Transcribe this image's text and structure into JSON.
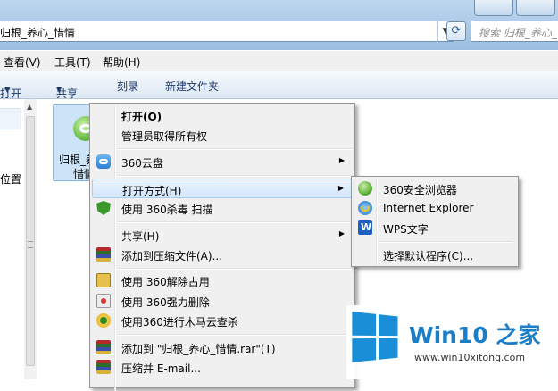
{
  "window": {
    "address_text": "归根_养心_惜情",
    "search_placeholder": "搜索 归根_养心_惜情"
  },
  "menubar": [
    "查看(V)",
    "工具(T)",
    "帮助(H)"
  ],
  "toolbar": {
    "open": "打开",
    "share": "共享",
    "burn": "刻录",
    "new_folder": "新建文件夹"
  },
  "navpane": {
    "location": "位置"
  },
  "file": {
    "name_line1": "归根_养",
    "name_line2": "惜情"
  },
  "context_menu": [
    {
      "label": "打开(O)",
      "bold": true,
      "icon": null
    },
    {
      "label": "管理员取得所有权",
      "icon": null
    },
    {
      "label": "360云盘",
      "icon": "cloud-icon",
      "submenu": true
    },
    {
      "label": "打开方式(H)",
      "icon": null,
      "submenu": true,
      "highlighted": true
    },
    {
      "label": "使用 360杀毒 扫描",
      "icon": "shield-icon"
    },
    {
      "label": "共享(H)",
      "icon": null,
      "submenu": true
    },
    {
      "label": "添加到压缩文件(A)...",
      "icon": "archive-icon"
    },
    {
      "label": "使用 360解除占用",
      "icon": "unlock-icon"
    },
    {
      "label": "使用 360强力删除",
      "icon": "force-delete-icon"
    },
    {
      "label": "使用360进行木马云查杀",
      "icon": "trojan-scan-icon"
    },
    {
      "label": "添加到 \"归根_养心_惜情.rar\"(T)",
      "icon": "archive-icon"
    },
    {
      "label": "压缩并 E-mail...",
      "icon": "archive-icon"
    }
  ],
  "open_with_submenu": [
    {
      "label": "360安全浏览器",
      "icon": "360-browser-icon"
    },
    {
      "label": "Internet Explorer",
      "icon": "ie-icon"
    },
    {
      "label": "WPS文字",
      "icon": "wps-icon"
    },
    {
      "label": "选择默认程序(C)...",
      "icon": null
    }
  ],
  "watermark": {
    "brand": "Win10 之家",
    "url": "www.win10xitong.com"
  },
  "colors": {
    "highlight": "#d3e6fb",
    "menu_bg": "#f0f0f0",
    "brand_blue": "#1a7ec8"
  }
}
